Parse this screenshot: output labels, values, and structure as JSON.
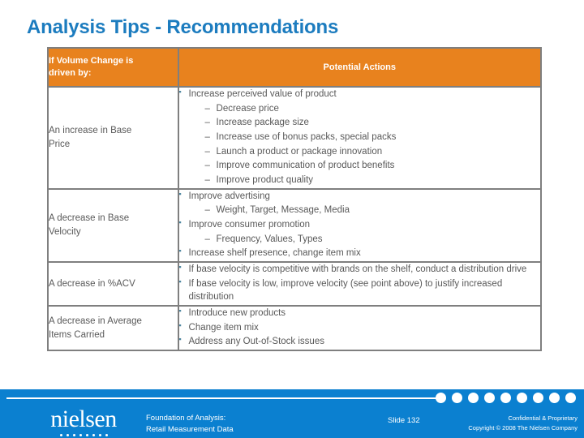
{
  "slide": {
    "title": "Analysis Tips - Recommendations"
  },
  "colors": {
    "title_blue": "#1C7CBF",
    "header_orange": "#E8821E",
    "footer_blue": "#0B80D0",
    "body_gray": "#595959",
    "border_gray": "#7F7F7F",
    "bullet_teal": "#4E87A0"
  },
  "table": {
    "headers": {
      "driver": "If Volume Change is driven by:",
      "driver_line1": "If Volume Change is",
      "driver_line2": "driven by:",
      "actions": "Potential Actions"
    },
    "rows": [
      {
        "driver_line1": "An increase in Base",
        "driver_line2": "Price",
        "actions": [
          {
            "level": 1,
            "text": "Increase perceived value of product"
          },
          {
            "level": 2,
            "text": "Decrease price"
          },
          {
            "level": 2,
            "text": "Increase package size"
          },
          {
            "level": 2,
            "text": "Increase use of bonus packs, special packs"
          },
          {
            "level": 2,
            "text": "Launch a product or package innovation"
          },
          {
            "level": 2,
            "text": "Improve communication of product benefits"
          },
          {
            "level": 2,
            "text": "Improve product quality"
          }
        ]
      },
      {
        "driver_line1": "A decrease in Base",
        "driver_line2": "Velocity",
        "actions": [
          {
            "level": 1,
            "text": "Improve advertising"
          },
          {
            "level": 2,
            "text": "Weight, Target, Message, Media"
          },
          {
            "level": 1,
            "text": "Improve consumer promotion"
          },
          {
            "level": 2,
            "text": "Frequency, Values, Types"
          },
          {
            "level": 1,
            "text": "Increase shelf presence, change item mix"
          }
        ]
      },
      {
        "driver_line1": "A decrease in %ACV",
        "driver_line2": "",
        "actions": [
          {
            "level": 1,
            "text": "If base velocity is competitive with brands on the shelf, conduct a distribution drive"
          },
          {
            "level": 1,
            "text": "If base velocity is low, improve velocity (see point above) to justify increased distribution"
          }
        ]
      },
      {
        "driver_line1": "A decrease in Average",
        "driver_line2": "Items Carried",
        "actions": [
          {
            "level": 1,
            "text": "Introduce new products"
          },
          {
            "level": 1,
            "text": "Change item mix"
          },
          {
            "level": 1,
            "text": "Address any Out-of-Stock issues"
          }
        ]
      }
    ]
  },
  "footer": {
    "brand": "nielsen",
    "subject_line1": "Foundation of Analysis:",
    "subject_line2": "Retail Measurement Data",
    "slide_number": "Slide  132",
    "legal_line1": "Confidential & Proprietary",
    "legal_line2": "Copyright © 2008 The Nielsen Company",
    "dot_count": 9,
    "brand_dot_count": 8
  }
}
